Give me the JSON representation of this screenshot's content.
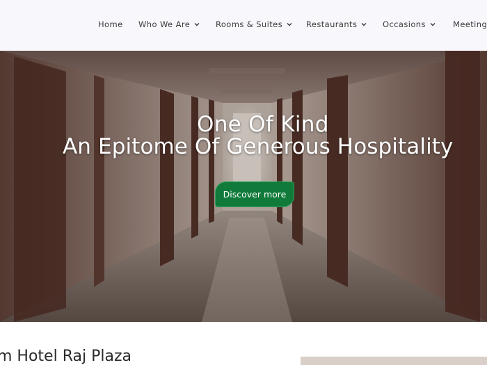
{
  "nav": {
    "items": [
      {
        "label": "Home",
        "dropdown": false
      },
      {
        "label": "Who We Are",
        "dropdown": true
      },
      {
        "label": "Rooms & Suites",
        "dropdown": true
      },
      {
        "label": "Restaurants",
        "dropdown": true
      },
      {
        "label": "Occasions",
        "dropdown": true
      },
      {
        "label": "Meeting",
        "dropdown": false
      }
    ]
  },
  "hero": {
    "line1": "One Of Kind",
    "line2": "An Epitome Of Generous Hospitality",
    "cta_label": "Discover more"
  },
  "intro": {
    "heading": "m Hotel Raj Plaza"
  },
  "colors": {
    "header_bg": "#f8f7fb",
    "cta_bg": "#0f7a3a",
    "nav_text": "#3a3a3a"
  },
  "icons": {
    "dropdown": "chevron-down-icon"
  }
}
